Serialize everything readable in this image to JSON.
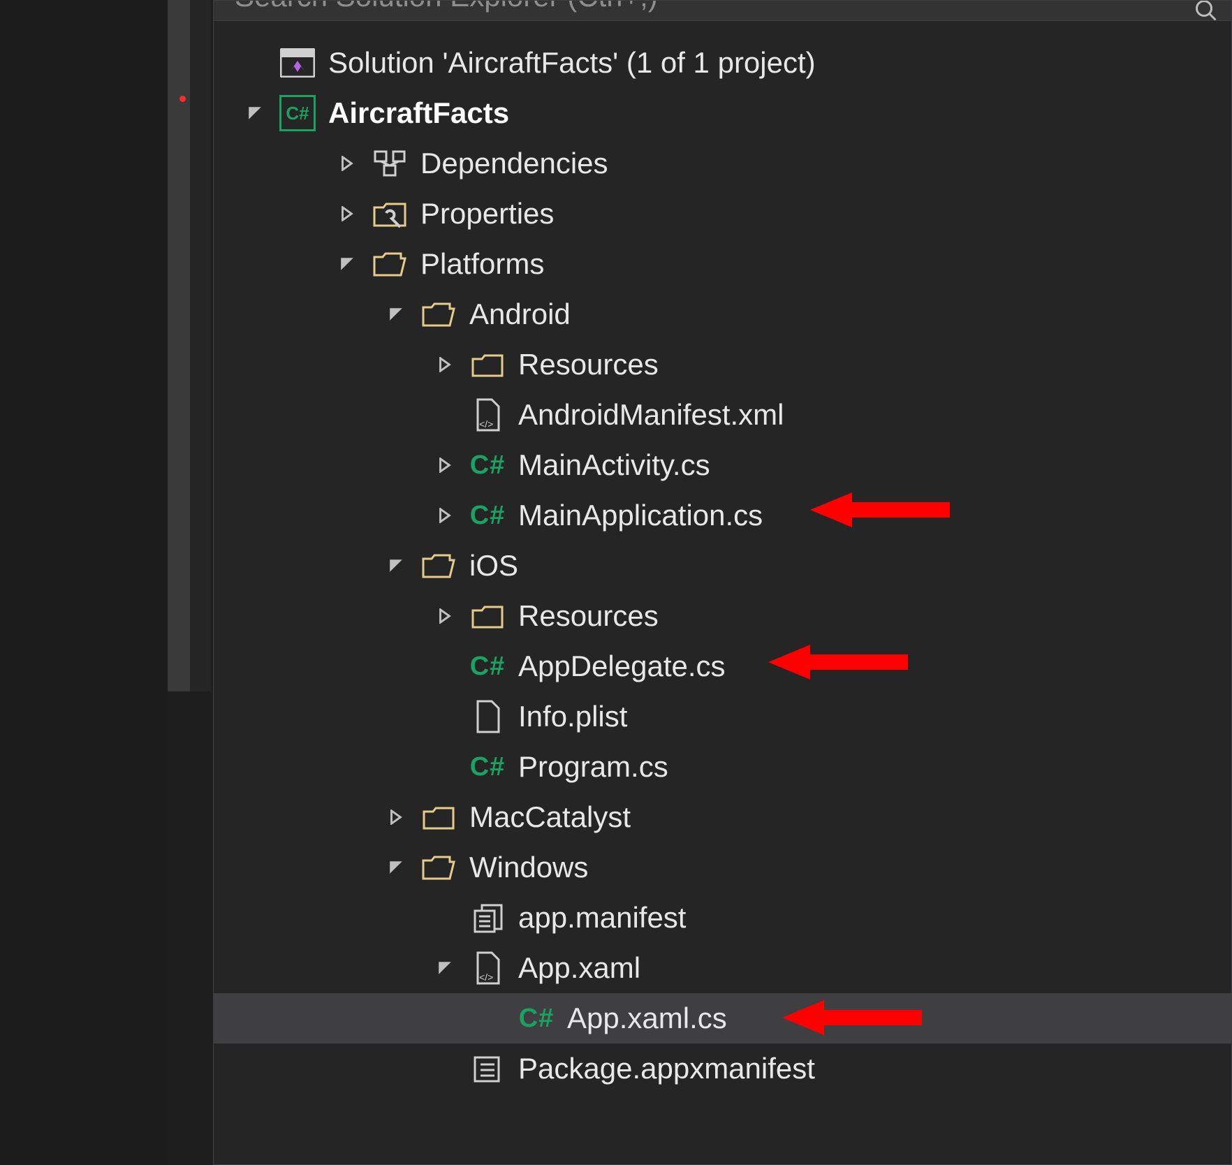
{
  "search": {
    "placeholder": "Search Solution Explorer (Ctrl+;)"
  },
  "solution": {
    "label": "Solution 'AircraftFacts' (1 of 1 project)",
    "project": "AircraftFacts"
  },
  "nodes": {
    "dependencies": "Dependencies",
    "properties": "Properties",
    "platforms": "Platforms",
    "android": "Android",
    "android_resources": "Resources",
    "android_manifest": "AndroidManifest.xml",
    "main_activity": "MainActivity.cs",
    "main_application": "MainApplication.cs",
    "ios": "iOS",
    "ios_resources": "Resources",
    "app_delegate": "AppDelegate.cs",
    "info_plist": "Info.plist",
    "program_cs": "Program.cs",
    "mac_catalyst": "MacCatalyst",
    "windows": "Windows",
    "app_manifest": "app.manifest",
    "app_xaml": "App.xaml",
    "app_xaml_cs": "App.xaml.cs",
    "package_appx": "Package.appxmanifest"
  },
  "cs_badge": "C#"
}
